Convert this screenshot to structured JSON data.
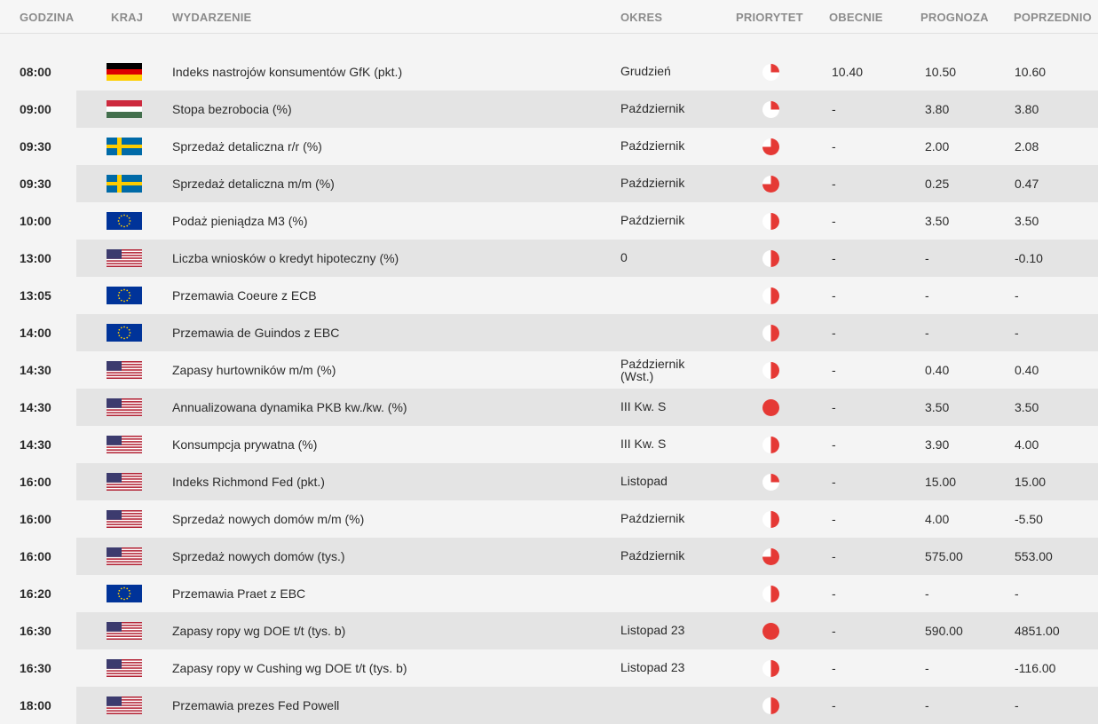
{
  "headers": {
    "time": "GODZINA",
    "country": "KRAJ",
    "event": "WYDARZENIE",
    "period": "OKRES",
    "priority": "PRIORYTET",
    "actual": "OBECNIE",
    "forecast": "PROGNOZA",
    "previous": "POPRZEDNIO"
  },
  "colors": {
    "priority_red": "#e53935"
  },
  "rows": [
    {
      "time": "08:00",
      "flag": "de",
      "event": "Indeks nastrojów konsumentów GfK (pkt.)",
      "period": "Grudzień",
      "priority": "low",
      "actual": "10.40",
      "forecast": "10.50",
      "previous": "10.60"
    },
    {
      "time": "09:00",
      "flag": "hu",
      "event": "Stopa bezrobocia (%)",
      "period": "Październik",
      "priority": "low",
      "actual": "-",
      "forecast": "3.80",
      "previous": "3.80"
    },
    {
      "time": "09:30",
      "flag": "se",
      "event": "Sprzedaż detaliczna r/r (%)",
      "period": "Październik",
      "priority": "high3",
      "actual": "-",
      "forecast": "2.00",
      "previous": "2.08"
    },
    {
      "time": "09:30",
      "flag": "se",
      "event": "Sprzedaż detaliczna m/m (%)",
      "period": "Październik",
      "priority": "high3",
      "actual": "-",
      "forecast": "0.25",
      "previous": "0.47"
    },
    {
      "time": "10:00",
      "flag": "eu",
      "event": "Podaż pieniądza M3 (%)",
      "period": "Październik",
      "priority": "medium",
      "actual": "-",
      "forecast": "3.50",
      "previous": "3.50"
    },
    {
      "time": "13:00",
      "flag": "us",
      "event": "Liczba wniosków o kredyt hipoteczny (%)",
      "period": "0",
      "priority": "medium",
      "actual": "-",
      "forecast": "-",
      "previous": "-0.10"
    },
    {
      "time": "13:05",
      "flag": "eu",
      "event": "Przemawia Coeure z ECB",
      "period": "",
      "priority": "medium",
      "actual": "-",
      "forecast": "-",
      "previous": "-"
    },
    {
      "time": "14:00",
      "flag": "eu",
      "event": "Przemawia de Guindos z EBC",
      "period": "",
      "priority": "medium",
      "actual": "-",
      "forecast": "-",
      "previous": "-"
    },
    {
      "time": "14:30",
      "flag": "us",
      "event": "Zapasy hurtowników m/m (%)",
      "period": "Październik",
      "period2": "(Wst.)",
      "priority": "medium",
      "actual": "-",
      "forecast": "0.40",
      "previous": "0.40"
    },
    {
      "time": "14:30",
      "flag": "us",
      "event": "Annualizowana dynamika PKB kw./kw. (%)",
      "period": "III Kw. S",
      "priority": "full",
      "actual": "-",
      "forecast": "3.50",
      "previous": "3.50"
    },
    {
      "time": "14:30",
      "flag": "us",
      "event": "Konsumpcja prywatna (%)",
      "period": "III Kw. S",
      "priority": "medium",
      "actual": "-",
      "forecast": "3.90",
      "previous": "4.00"
    },
    {
      "time": "16:00",
      "flag": "us",
      "event": "Indeks Richmond Fed (pkt.)",
      "period": "Listopad",
      "priority": "low",
      "actual": "-",
      "forecast": "15.00",
      "previous": "15.00"
    },
    {
      "time": "16:00",
      "flag": "us",
      "event": "Sprzedaż nowych domów m/m (%)",
      "period": "Październik",
      "priority": "medium",
      "actual": "-",
      "forecast": "4.00",
      "previous": "-5.50"
    },
    {
      "time": "16:00",
      "flag": "us",
      "event": "Sprzedaż nowych domów (tys.)",
      "period": "Październik",
      "priority": "high3",
      "actual": "-",
      "forecast": "575.00",
      "previous": "553.00"
    },
    {
      "time": "16:20",
      "flag": "eu",
      "event": "Przemawia Praet z EBC",
      "period": "",
      "priority": "medium",
      "actual": "-",
      "forecast": "-",
      "previous": "-"
    },
    {
      "time": "16:30",
      "flag": "us",
      "event": "Zapasy ropy wg DOE t/t (tys. b)",
      "period": "Listopad 23",
      "priority": "full",
      "actual": "-",
      "forecast": "590.00",
      "previous": "4851.00"
    },
    {
      "time": "16:30",
      "flag": "us",
      "event": "Zapasy ropy w Cushing wg DOE t/t (tys. b)",
      "period": "Listopad 23",
      "priority": "medium",
      "actual": "-",
      "forecast": "-",
      "previous": "-116.00"
    },
    {
      "time": "18:00",
      "flag": "us",
      "event": "Przemawia prezes Fed Powell",
      "period": "",
      "priority": "medium",
      "actual": "-",
      "forecast": "-",
      "previous": "-"
    }
  ]
}
